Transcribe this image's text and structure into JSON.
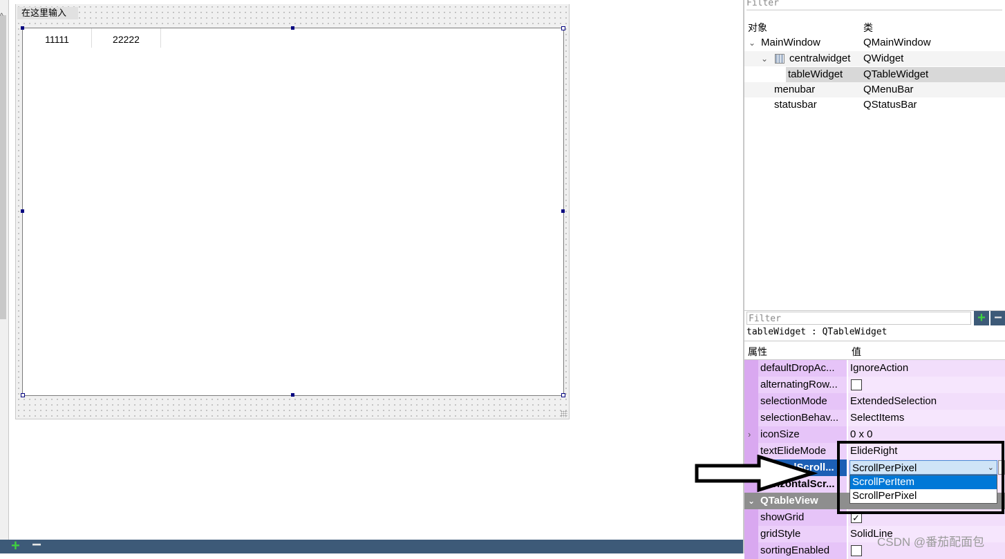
{
  "designer": {
    "menu_placeholder": "在这里输入",
    "table_headers": [
      "11111",
      "22222"
    ]
  },
  "object_inspector": {
    "filter_placeholder": "Filter",
    "col_object": "对象",
    "col_class": "类",
    "rows": [
      {
        "name": "MainWindow",
        "class": "QMainWindow",
        "expanded": true
      },
      {
        "name": "centralwidget",
        "class": "QWidget",
        "expanded": true,
        "icon": "grid-layout-icon"
      },
      {
        "name": "tableWidget",
        "class": "QTableWidget",
        "selected": true
      },
      {
        "name": "menubar",
        "class": "QMenuBar"
      },
      {
        "name": "statusbar",
        "class": "QStatusBar"
      }
    ]
  },
  "property_editor": {
    "filter_placeholder": "Filter",
    "add_icon": "plus-icon",
    "remove_icon": "minus-icon",
    "object_label": "tableWidget : QTableWidget",
    "col_property": "属性",
    "col_value": "值",
    "rows": [
      {
        "name": "defaultDropAc...",
        "value": "IgnoreAction"
      },
      {
        "name": "alternatingRow...",
        "value": "",
        "checkbox": false
      },
      {
        "name": "selectionMode",
        "value": "ExtendedSelection"
      },
      {
        "name": "selectionBehav...",
        "value": "SelectItems"
      },
      {
        "name": "iconSize",
        "value": "0 x 0",
        "expandable": true
      },
      {
        "name": "textElideMode",
        "value": "ElideRight"
      },
      {
        "name": "verticalScroll...",
        "value": "ScrollPerPixel",
        "selected": true
      },
      {
        "name": "horizontalScr...",
        "value": ""
      }
    ],
    "section": "QTableView",
    "section_rows": [
      {
        "name": "showGrid",
        "checkbox": true
      },
      {
        "name": "gridStyle",
        "value": "SolidLine"
      },
      {
        "name": "sortingEnabled",
        "checkbox": false
      }
    ],
    "combo": {
      "value": "ScrollPerPixel",
      "options": [
        "ScrollPerItem",
        "ScrollPerPixel"
      ],
      "highlighted": "ScrollPerItem"
    }
  },
  "bottom_bar": {
    "add_icon": "plus-icon",
    "remove_icon": "minus-icon"
  },
  "watermark": "CSDN @番茄配面包",
  "colors": {
    "accent": "#0078d7",
    "selection": "#1c5fb5",
    "prop_pink": "#e6c4f8",
    "bar": "#3d5a78"
  }
}
